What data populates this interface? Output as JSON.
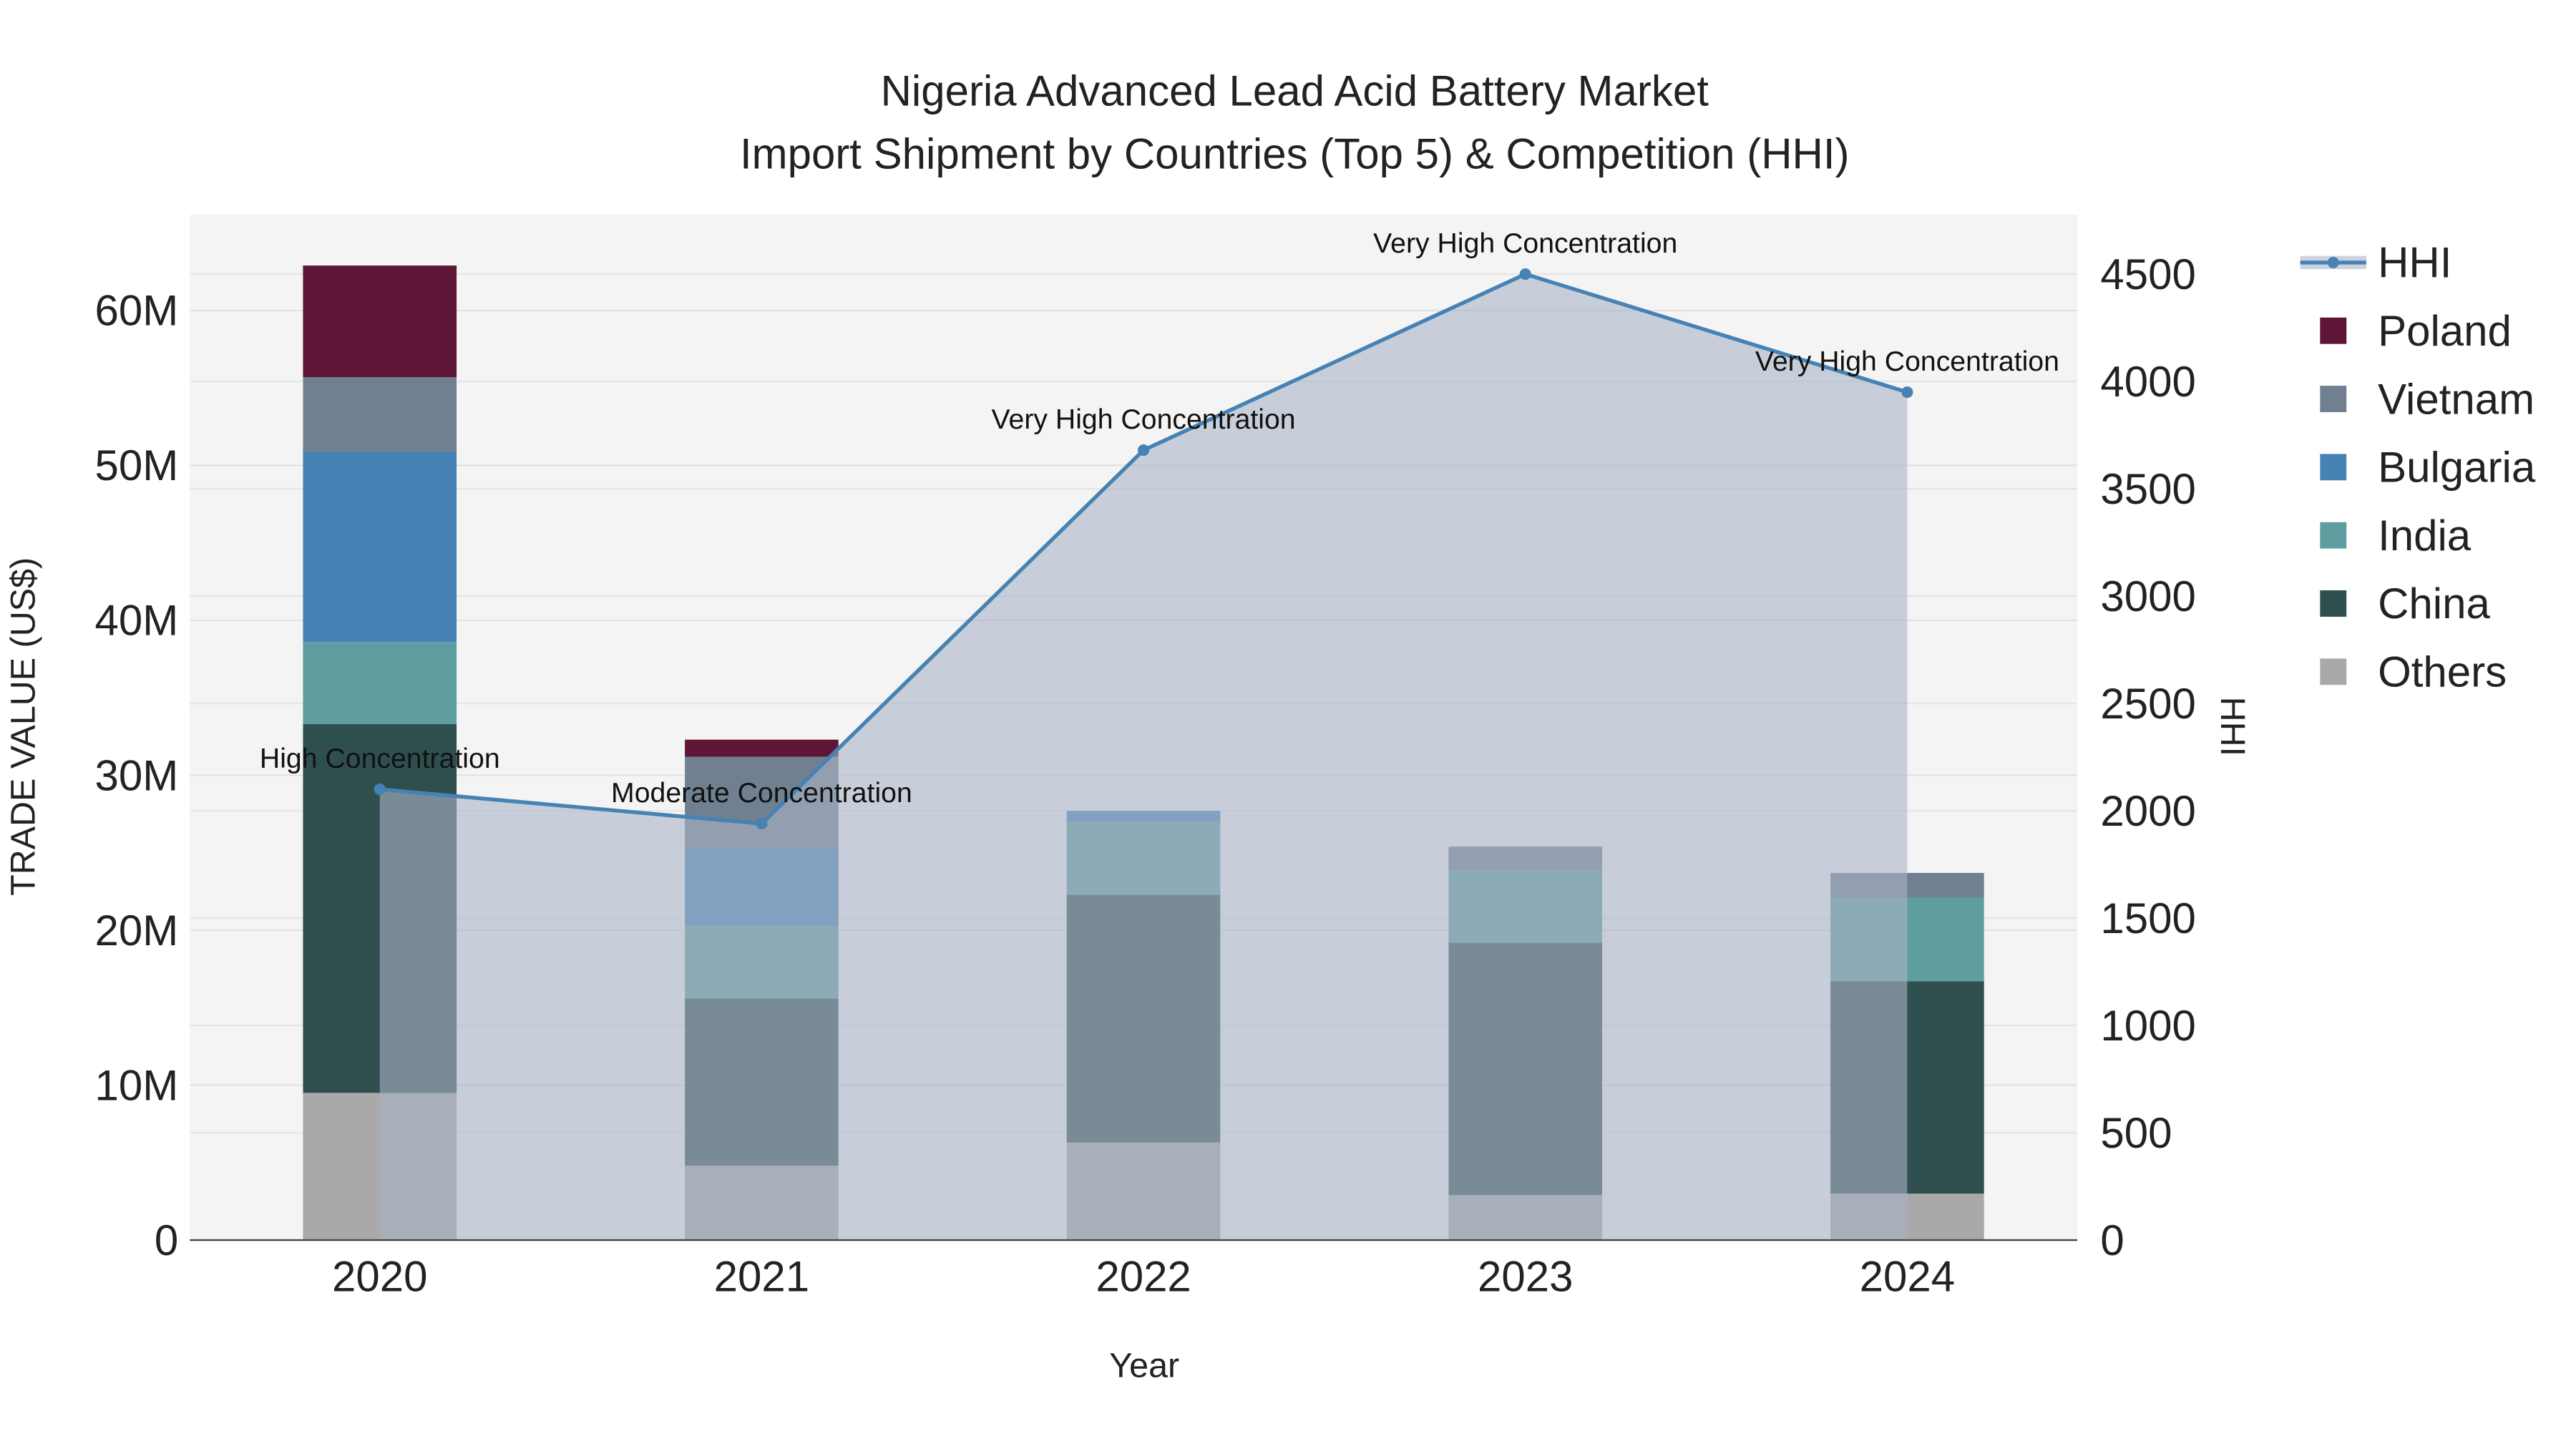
{
  "chart_data": {
    "type": "bar",
    "title": "Nigeria Advanced Lead Acid Battery Market",
    "subtitle": "Import Shipment by Countries (Top 5) & Competition (HHI)",
    "xlabel": "Year",
    "ylabel": "TRADE VALUE (US$)",
    "y2label": "HHI",
    "categories": [
      "2020",
      "2021",
      "2022",
      "2023",
      "2024"
    ],
    "ylim": [
      0,
      66000000
    ],
    "y2lim": [
      0,
      4780
    ],
    "yticks": [
      0,
      10000000,
      20000000,
      30000000,
      40000000,
      50000000,
      60000000
    ],
    "ytick_labels": [
      "0",
      "10M",
      "20M",
      "30M",
      "40M",
      "50M",
      "60M"
    ],
    "y2ticks": [
      0,
      500,
      1000,
      1500,
      2000,
      2500,
      3000,
      3500,
      4000,
      4500
    ],
    "y2tick_labels": [
      "0",
      "500",
      "1000",
      "1500",
      "2000",
      "2500",
      "3000",
      "3500",
      "4000",
      "4500"
    ],
    "series": [
      {
        "name": "Others",
        "color": "#a9a9a9",
        "values": [
          9500000,
          4800000,
          6300000,
          2900000,
          3000000
        ]
      },
      {
        "name": "China",
        "color": "#2f4f4f",
        "values": [
          23800000,
          10800000,
          16000000,
          16300000,
          13700000
        ]
      },
      {
        "name": "India",
        "color": "#5f9ea0",
        "values": [
          5300000,
          4700000,
          4700000,
          4700000,
          5400000
        ]
      },
      {
        "name": "Bulgaria",
        "color": "#4682b4",
        "values": [
          12300000,
          5000000,
          700000,
          0,
          0
        ]
      },
      {
        "name": "Vietnam",
        "color": "#708090",
        "values": [
          4800000,
          5900000,
          0,
          1500000,
          1600000
        ]
      },
      {
        "name": "Poland",
        "color": "#5f1535",
        "values": [
          7200000,
          1100000,
          0,
          0,
          0
        ]
      }
    ],
    "hhi": {
      "name": "HHI",
      "color": "#4682b4",
      "values": [
        2100,
        1940,
        3680,
        4500,
        3950
      ],
      "annotations": [
        "High Concentration",
        "Moderate Concentration",
        "Very High Concentration",
        "Very High Concentration",
        "Very High Concentration"
      ]
    },
    "legend": {
      "placement": "right",
      "order": [
        "HHI",
        "Poland",
        "Vietnam",
        "Bulgaria",
        "India",
        "China",
        "Others"
      ]
    },
    "grid": true
  }
}
